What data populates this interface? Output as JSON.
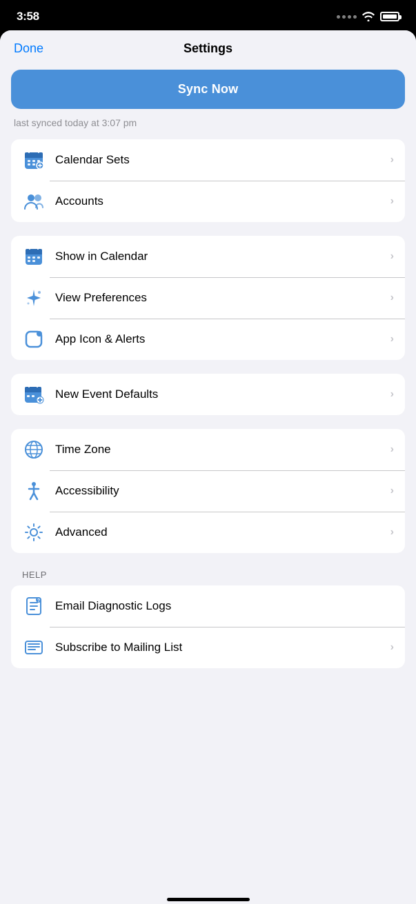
{
  "statusBar": {
    "time": "3:58"
  },
  "navBar": {
    "doneLabel": "Done",
    "title": "Settings"
  },
  "syncButton": {
    "label": "Sync Now"
  },
  "syncStatus": {
    "text": "last synced today at 3:07 pm"
  },
  "groups": [
    {
      "id": "group1",
      "rows": [
        {
          "id": "calendar-sets",
          "label": "Calendar Sets",
          "iconType": "calendar-sets"
        },
        {
          "id": "accounts",
          "label": "Accounts",
          "iconType": "accounts"
        }
      ]
    },
    {
      "id": "group2",
      "rows": [
        {
          "id": "show-in-calendar",
          "label": "Show in Calendar",
          "iconType": "show-calendar"
        },
        {
          "id": "view-preferences",
          "label": "View Preferences",
          "iconType": "sparkle"
        },
        {
          "id": "app-icon-alerts",
          "label": "App Icon & Alerts",
          "iconType": "app-icon"
        }
      ]
    },
    {
      "id": "group3",
      "rows": [
        {
          "id": "new-event-defaults",
          "label": "New Event Defaults",
          "iconType": "new-event"
        }
      ]
    },
    {
      "id": "group4",
      "rows": [
        {
          "id": "time-zone",
          "label": "Time Zone",
          "iconType": "globe"
        },
        {
          "id": "accessibility",
          "label": "Accessibility",
          "iconType": "accessibility"
        },
        {
          "id": "advanced",
          "label": "Advanced",
          "iconType": "gear"
        }
      ]
    }
  ],
  "helpSection": {
    "header": "HELP",
    "rows": [
      {
        "id": "email-diagnostic",
        "label": "Email Diagnostic Logs",
        "iconType": "diagnostic",
        "hasChevron": false
      },
      {
        "id": "subscribe-mailing",
        "label": "Subscribe to Mailing List",
        "iconType": "mailing",
        "hasChevron": true
      }
    ]
  }
}
